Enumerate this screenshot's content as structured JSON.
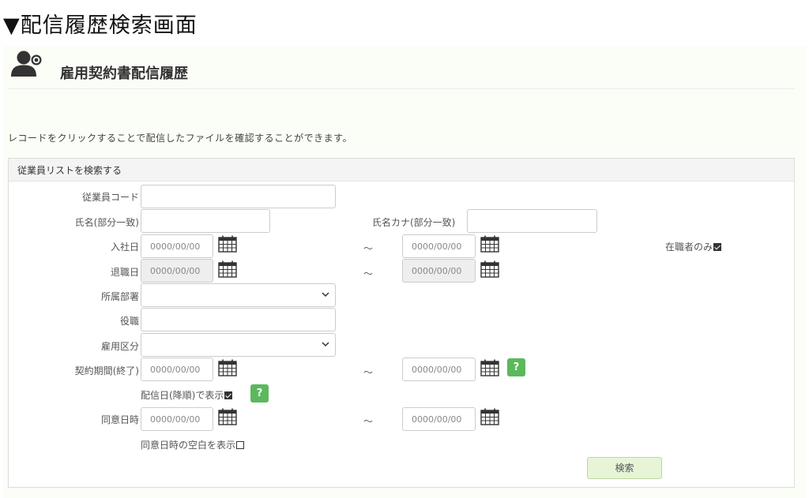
{
  "caption": "▼配信履歴検索画面",
  "header": {
    "title": "雇用契約書配信履歴",
    "icon": "user-add-icon"
  },
  "instruction": "レコードをクリックすることで配信したファイルを確認することができます。",
  "search_panel": {
    "title": "従業員リストを検索する",
    "fields": {
      "employee_code": {
        "label": "従業員コード",
        "value": ""
      },
      "name": {
        "label": "氏名(部分一致)",
        "value": ""
      },
      "name_kana": {
        "label": "氏名カナ(部分一致)",
        "value": ""
      },
      "hire_date": {
        "label": "入社日",
        "from_placeholder": "0000/00/00",
        "to_placeholder": "0000/00/00"
      },
      "active_only": {
        "label": "在職者のみ",
        "checked": true
      },
      "retire_date": {
        "label": "退職日",
        "from_placeholder": "0000/00/00",
        "to_placeholder": "0000/00/00"
      },
      "department": {
        "label": "所属部署",
        "value": ""
      },
      "position": {
        "label": "役職",
        "value": ""
      },
      "employment_type": {
        "label": "雇用区分",
        "value": ""
      },
      "contract_end": {
        "label": "契約期間(終了)",
        "from_placeholder": "0000/00/00",
        "to_placeholder": "0000/00/00",
        "help": "?"
      },
      "sort_by_delivery": {
        "label": "配信日(降順)で表示",
        "checked": true,
        "help": "?"
      },
      "consent_datetime": {
        "label": "同意日時",
        "from_placeholder": "0000/00/00",
        "to_placeholder": "0000/00/00"
      },
      "show_blank_consent": {
        "label": "同意日時の空白を表示",
        "checked": false
      }
    },
    "range_separator": "～",
    "search_button": "検索"
  },
  "colors": {
    "accent_green": "#5cb85c",
    "button_bg": "#e7f5d6",
    "panel_bg": "#fbfdf7"
  }
}
